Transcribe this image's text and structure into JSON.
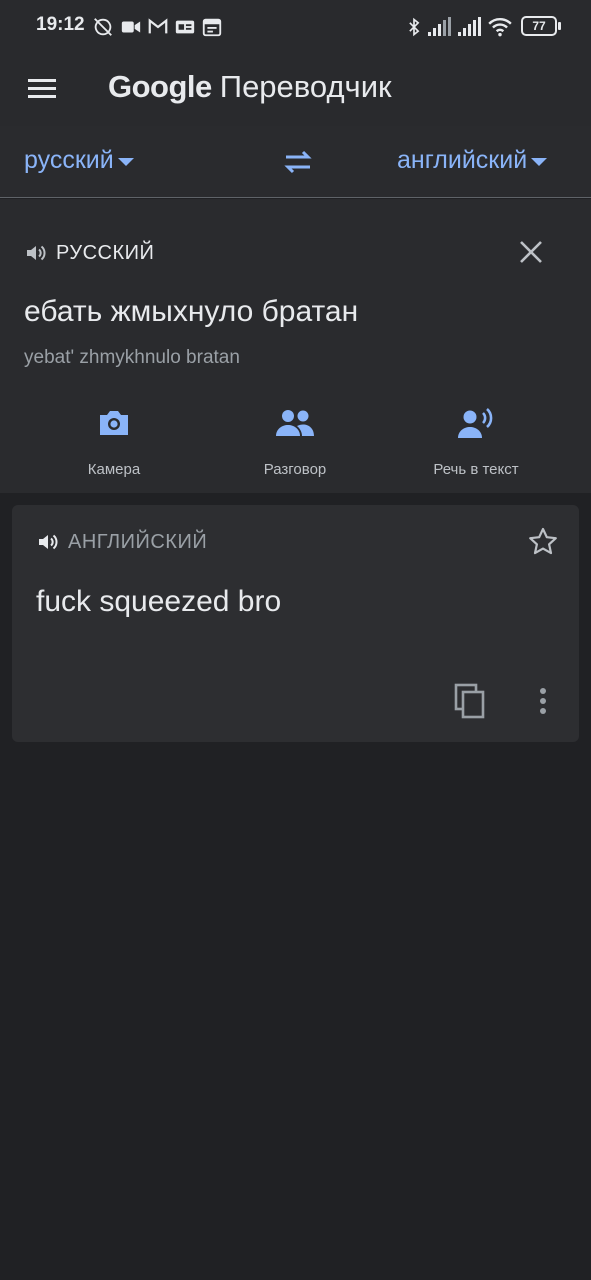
{
  "status_bar": {
    "time": "19:12",
    "battery": "77",
    "icons": [
      "alarm-off-icon",
      "video-icon",
      "gmail-icon",
      "news-icon",
      "calendar-icon",
      "bluetooth-icon",
      "signal-icon",
      "signal-icon",
      "wifi-icon",
      "battery-icon"
    ]
  },
  "app_bar": {
    "title_brand": "Google",
    "title_product": "Переводчик",
    "menu_icon": "hamburger-menu-icon"
  },
  "language_bar": {
    "source_language": "русский",
    "target_language": "английский",
    "swap_icon": "swap-arrows-icon"
  },
  "source_panel": {
    "language_label": "РУССКИЙ",
    "text": "ебать жмыхнуло братан",
    "transliteration": "yebat' zhmykhnulo bratan",
    "tools": [
      {
        "label": "Камера",
        "icon": "camera-icon"
      },
      {
        "label": "Разговор",
        "icon": "conversation-icon"
      },
      {
        "label": "Речь в текст",
        "icon": "speech-to-text-icon"
      }
    ]
  },
  "result_panel": {
    "language_label": "АНГЛИЙСКИЙ",
    "text": "fuck squeezed bro"
  },
  "colors": {
    "background": "#202124",
    "panel": "#2a2b2e",
    "card": "#2d2e31",
    "accent": "#8ab4f8"
  }
}
